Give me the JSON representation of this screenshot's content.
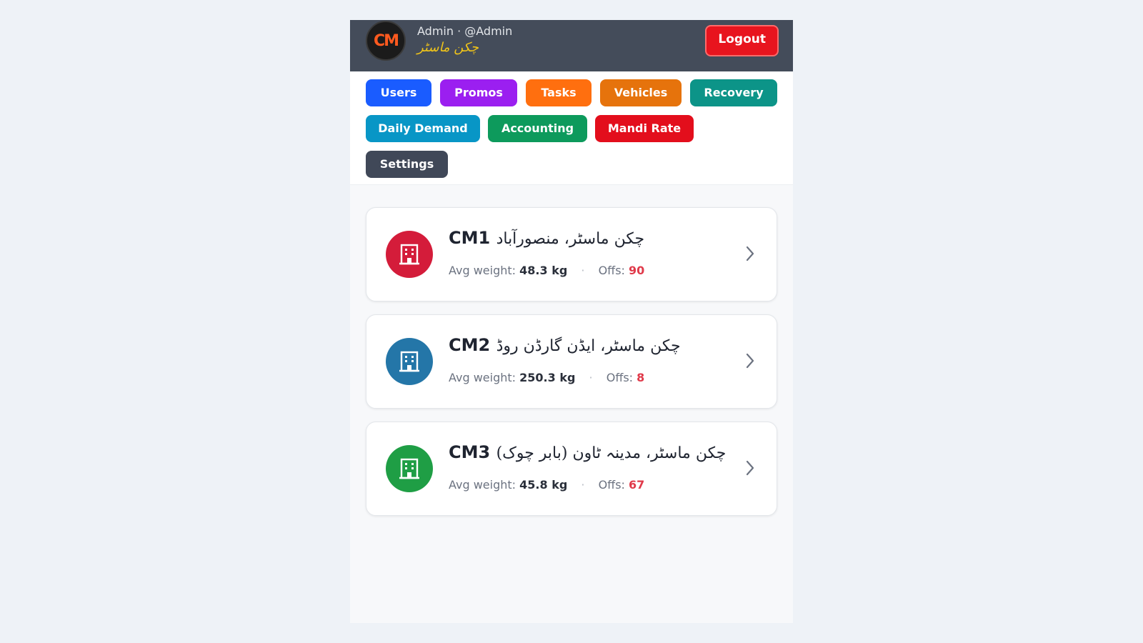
{
  "header": {
    "logo_text": "CM",
    "user_line": "Admin · @Admin",
    "brand_urdu": "چکن ماسٹر",
    "logout_label": "Logout",
    "bg_color": "#444c5a"
  },
  "nav": {
    "items": [
      {
        "label": "Users",
        "color": "#1a5cff"
      },
      {
        "label": "Promos",
        "color": "#9b1ff0"
      },
      {
        "label": "Tasks",
        "color": "#ff6f0f"
      },
      {
        "label": "Vehicles",
        "color": "#e6730c"
      },
      {
        "label": "Recovery",
        "color": "#0c9488"
      },
      {
        "label": "Daily Demand",
        "color": "#0896c6"
      },
      {
        "label": "Accounting",
        "color": "#0d9a5c"
      },
      {
        "label": "Mandi Rate",
        "color": "#e30e1c"
      },
      {
        "label": "Settings",
        "color": "#404858"
      }
    ]
  },
  "branches": [
    {
      "code": "CM1",
      "name_urdu": "چکن ماسٹر، منصورآباد",
      "avg_label": "Avg weight:",
      "avg_weight": "48.3 kg",
      "offs_label": "Offs:",
      "offs": "90",
      "icon": "building-icon",
      "icon_color": "#d41c3a"
    },
    {
      "code": "CM2",
      "name_urdu": "چکن ماسٹر، ایڈن گارڈن روڈ",
      "avg_label": "Avg weight:",
      "avg_weight": "250.3 kg",
      "offs_label": "Offs:",
      "offs": "8",
      "icon": "building-icon",
      "icon_color": "#2476a8"
    },
    {
      "code": "CM3",
      "name_urdu": "چکن ماسٹر، مدینہ ٹاون (بابر چوک)",
      "avg_label": "Avg weight:",
      "avg_weight": "45.8 kg",
      "offs_label": "Offs:",
      "offs": "67",
      "icon": "building-icon",
      "icon_color": "#1f9e45"
    }
  ],
  "separator": "·"
}
